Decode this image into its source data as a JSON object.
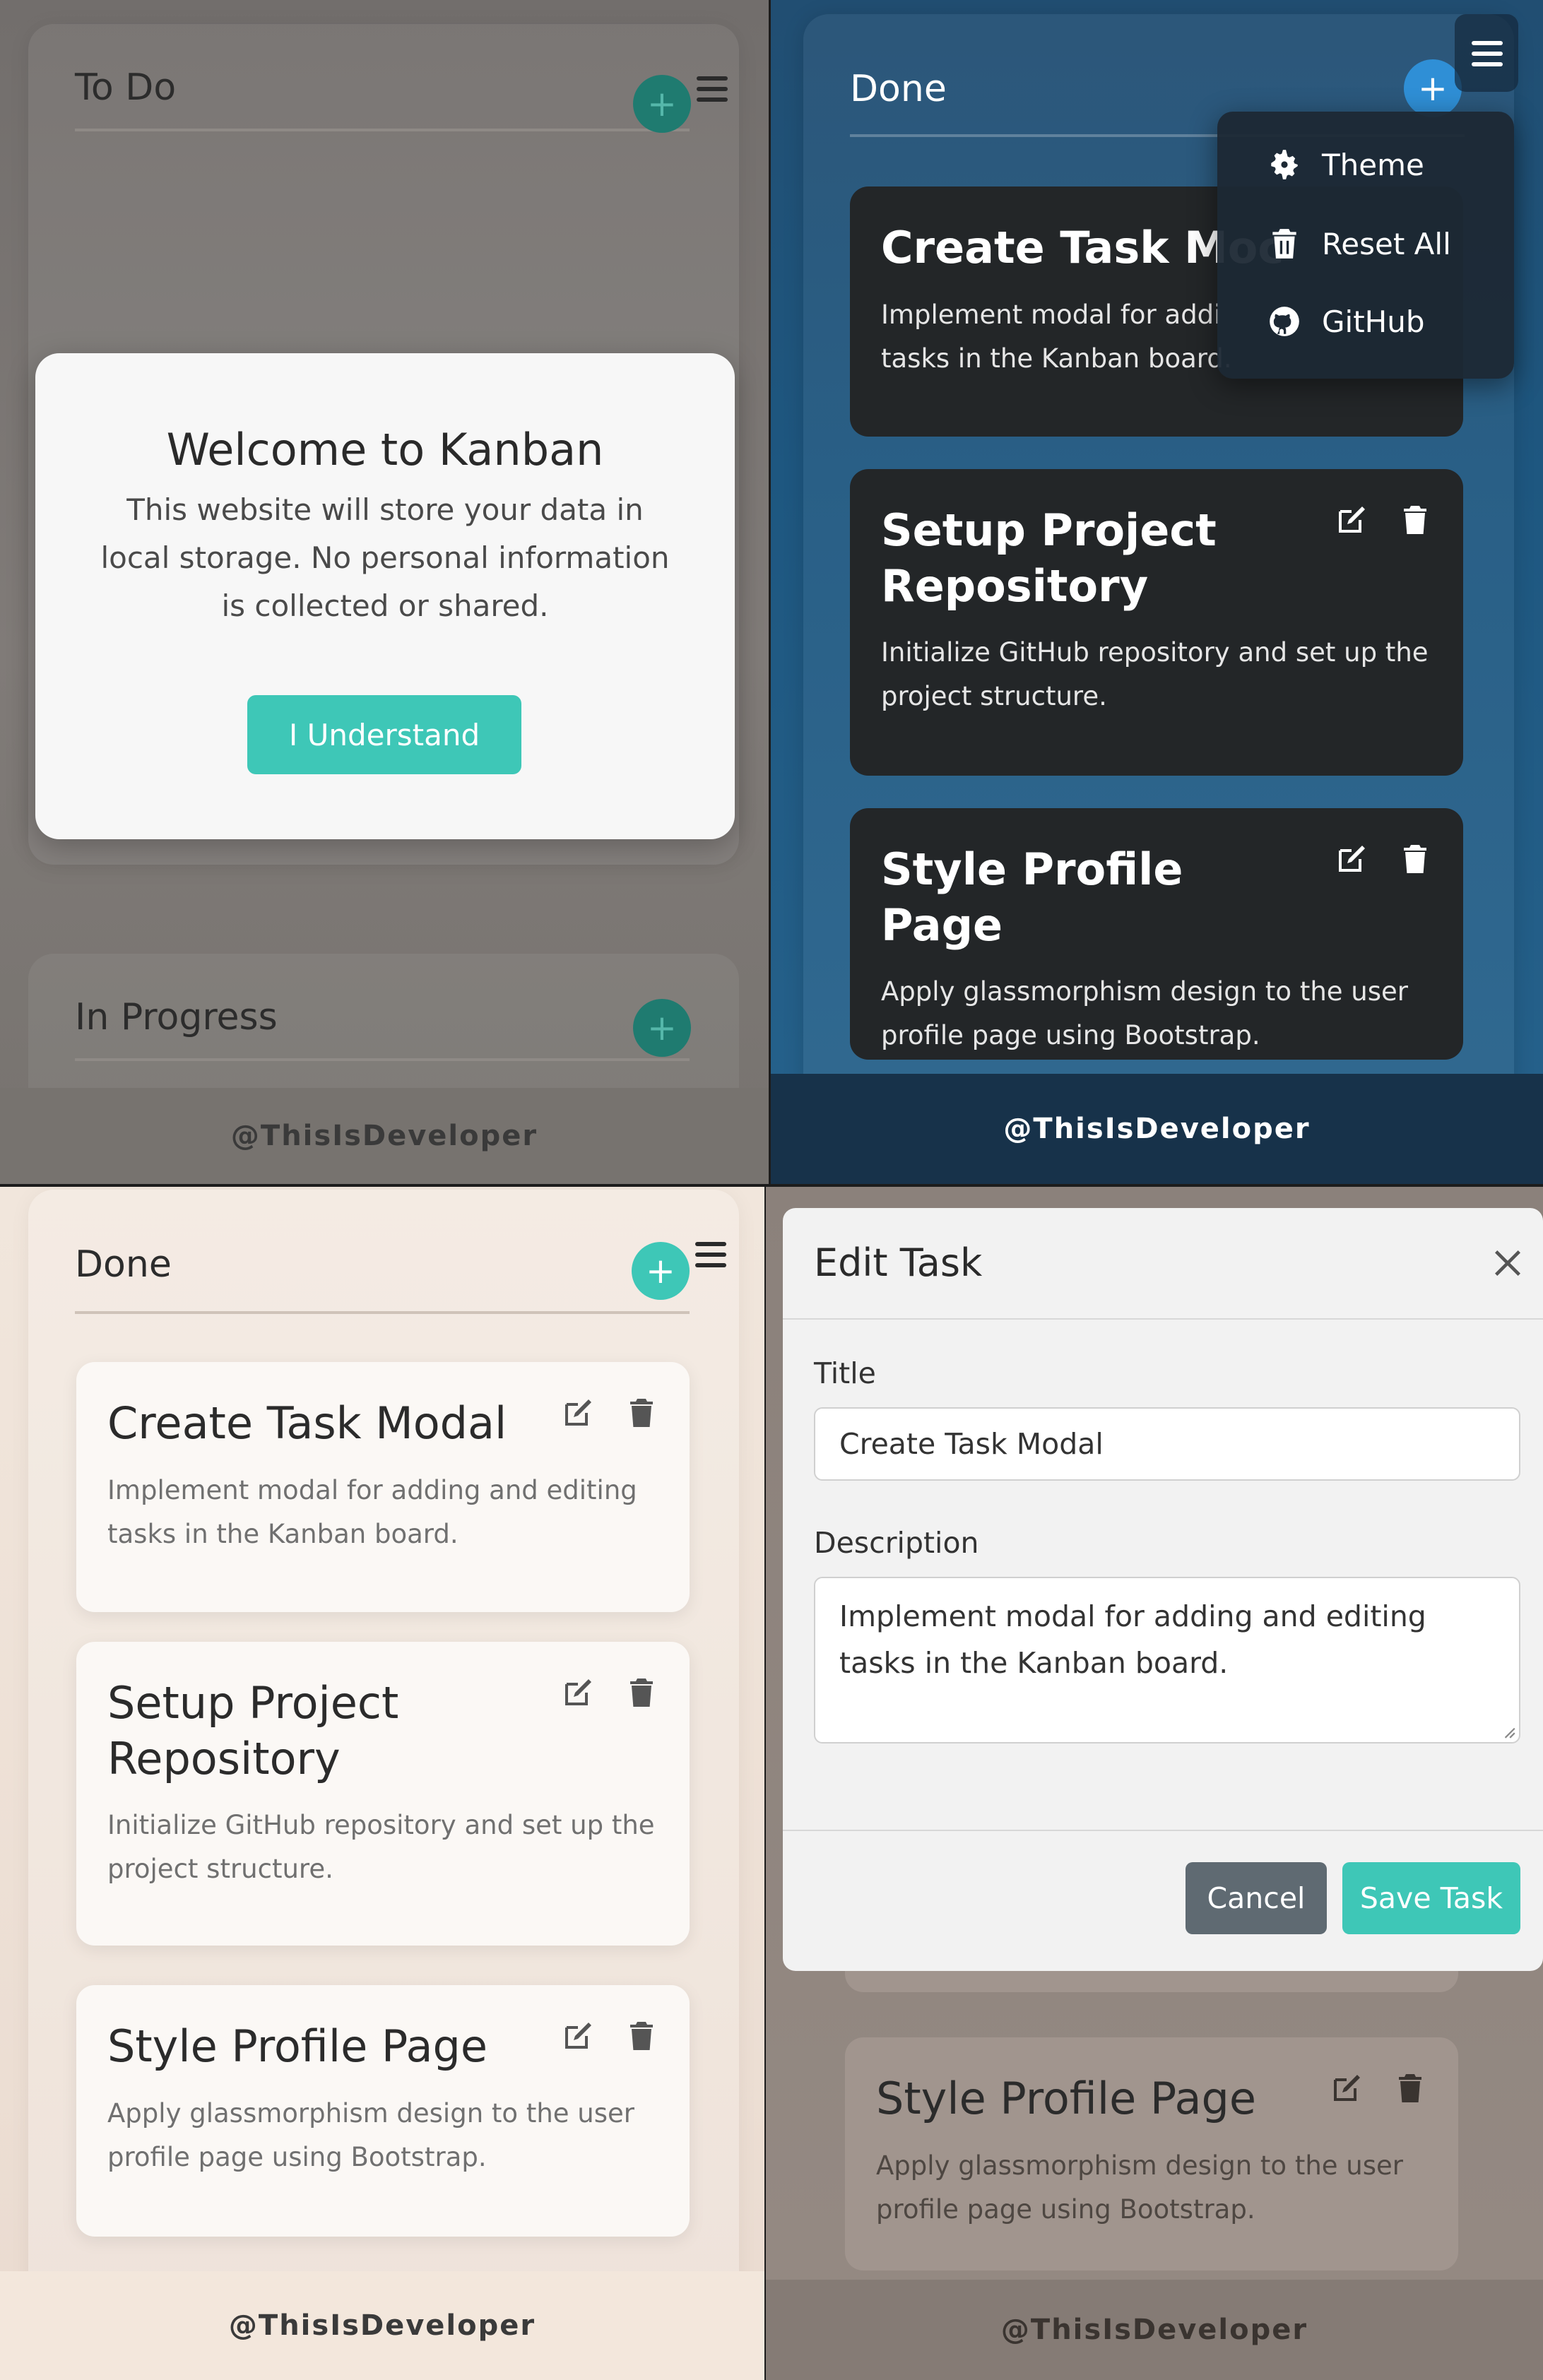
{
  "watermark": "@ThisIsDeveloper",
  "panel1": {
    "column_todo": "To Do",
    "column_inprogress": "In Progress",
    "welcome": {
      "title": "Welcome to Kanban",
      "message": "This website will store your data in local storage. No personal information is collected or shared.",
      "button": "I Understand"
    }
  },
  "panel2": {
    "column_title": "Done",
    "menu": {
      "theme": "Theme",
      "reset": "Reset All",
      "github": "GitHub"
    },
    "cards": [
      {
        "title": "Create Task Modal",
        "title_visible": "Create Task Moc",
        "desc": "Implement modal for adding and editing tasks in the Kanban board.",
        "desc_line1": "Implement modal for addi",
        "desc_line2": "tasks in the Kanban board."
      },
      {
        "title": "Setup Project Repository",
        "desc": "Initialize GitHub repository and set up the project structure."
      },
      {
        "title": "Style Profile Page",
        "desc": "Apply glassmorphism design to the user profile page using Bootstrap."
      }
    ]
  },
  "panel3": {
    "column_title": "Done",
    "cards": [
      {
        "title": "Create Task Modal",
        "desc": "Implement modal for adding and editing tasks in the Kanban board."
      },
      {
        "title": "Setup Project Repository",
        "desc": "Initialize GitHub repository and set up the project structure."
      },
      {
        "title": "Style Profile Page",
        "desc": "Apply glassmorphism design to the user profile page using Bootstrap."
      }
    ]
  },
  "panel4": {
    "modal_title": "Edit Task",
    "title_label": "Title",
    "title_value": "Create Task Modal",
    "description_label": "Description",
    "description_value": "Implement modal for adding and editing tasks in the Kanban board.",
    "cancel": "Cancel",
    "save": "Save Task",
    "bg_card": {
      "title": "Style Profile Page",
      "desc": "Apply glassmorphism design to the user profile page using Bootstrap."
    }
  },
  "colors": {
    "teal": "#3ec7b7",
    "blue_accent": "#2f8fd6",
    "dark_card": "#232628",
    "cancel_gray": "#5f6a72"
  },
  "icons": [
    "hamburger-menu-icon",
    "plus-icon",
    "edit-icon",
    "trash-icon",
    "gear-icon",
    "github-icon",
    "close-icon"
  ]
}
